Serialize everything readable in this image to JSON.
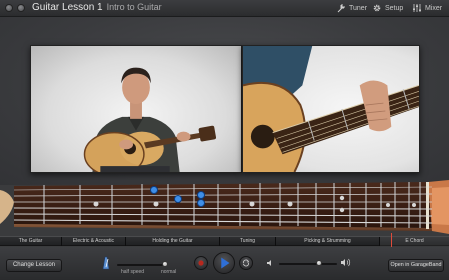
{
  "window": {
    "title": "Guitar Lesson 1",
    "subtitle": "Intro to Guitar"
  },
  "toolbar": {
    "tuner_label": "Tuner",
    "setup_label": "Setup",
    "mixer_label": "Mixer"
  },
  "chapters": [
    {
      "label": "The Guitar",
      "active": false
    },
    {
      "label": "Electric & Acoustic",
      "active": false
    },
    {
      "label": "Holding the Guitar",
      "active": false
    },
    {
      "label": "Tuning",
      "active": false
    },
    {
      "label": "Picking & Strumming",
      "active": false
    },
    {
      "label": "E Chord",
      "active": true
    }
  ],
  "controls": {
    "change_lesson_label": "Change Lesson",
    "speed_slow_label": "half speed",
    "speed_normal_label": "normal",
    "open_in_garageband_label": "Open in GarageBand",
    "volume_level": 0.7,
    "speed_level": 1.0
  },
  "colors": {
    "accent": "#2f6fd6",
    "note_marker": "#3f8fe8",
    "record": "#b8281e"
  },
  "icons": {
    "tuner": "tuning-fork-icon",
    "setup": "gear-icon",
    "mixer": "mixer-icon",
    "record": "record-icon",
    "play": "play-icon",
    "cycle": "cycle-icon",
    "volume_low": "volume-low-icon",
    "volume_high": "volume-high-icon",
    "metronome": "metronome-icon"
  }
}
